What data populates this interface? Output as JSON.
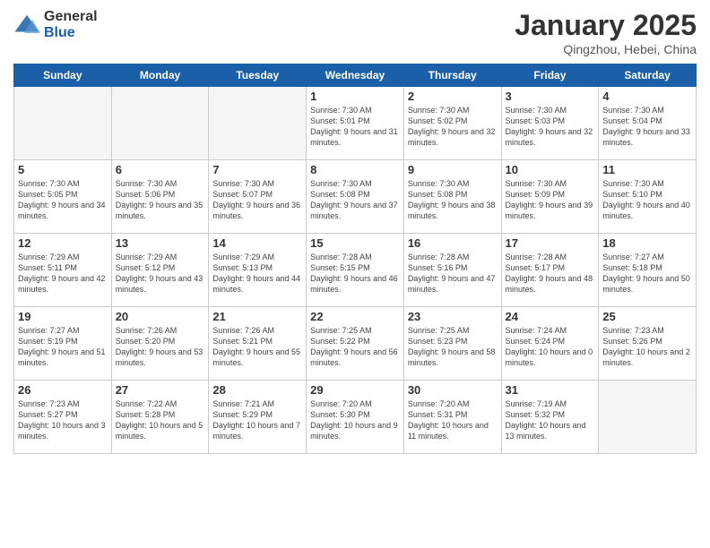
{
  "logo": {
    "general": "General",
    "blue": "Blue"
  },
  "header": {
    "month": "January 2025",
    "location": "Qingzhou, Hebei, China"
  },
  "weekdays": [
    "Sunday",
    "Monday",
    "Tuesday",
    "Wednesday",
    "Thursday",
    "Friday",
    "Saturday"
  ],
  "weeks": [
    [
      {
        "day": "",
        "info": ""
      },
      {
        "day": "",
        "info": ""
      },
      {
        "day": "",
        "info": ""
      },
      {
        "day": "1",
        "info": "Sunrise: 7:30 AM\nSunset: 5:01 PM\nDaylight: 9 hours\nand 31 minutes."
      },
      {
        "day": "2",
        "info": "Sunrise: 7:30 AM\nSunset: 5:02 PM\nDaylight: 9 hours\nand 32 minutes."
      },
      {
        "day": "3",
        "info": "Sunrise: 7:30 AM\nSunset: 5:03 PM\nDaylight: 9 hours\nand 32 minutes."
      },
      {
        "day": "4",
        "info": "Sunrise: 7:30 AM\nSunset: 5:04 PM\nDaylight: 9 hours\nand 33 minutes."
      }
    ],
    [
      {
        "day": "5",
        "info": "Sunrise: 7:30 AM\nSunset: 5:05 PM\nDaylight: 9 hours\nand 34 minutes."
      },
      {
        "day": "6",
        "info": "Sunrise: 7:30 AM\nSunset: 5:06 PM\nDaylight: 9 hours\nand 35 minutes."
      },
      {
        "day": "7",
        "info": "Sunrise: 7:30 AM\nSunset: 5:07 PM\nDaylight: 9 hours\nand 36 minutes."
      },
      {
        "day": "8",
        "info": "Sunrise: 7:30 AM\nSunset: 5:08 PM\nDaylight: 9 hours\nand 37 minutes."
      },
      {
        "day": "9",
        "info": "Sunrise: 7:30 AM\nSunset: 5:08 PM\nDaylight: 9 hours\nand 38 minutes."
      },
      {
        "day": "10",
        "info": "Sunrise: 7:30 AM\nSunset: 5:09 PM\nDaylight: 9 hours\nand 39 minutes."
      },
      {
        "day": "11",
        "info": "Sunrise: 7:30 AM\nSunset: 5:10 PM\nDaylight: 9 hours\nand 40 minutes."
      }
    ],
    [
      {
        "day": "12",
        "info": "Sunrise: 7:29 AM\nSunset: 5:11 PM\nDaylight: 9 hours\nand 42 minutes."
      },
      {
        "day": "13",
        "info": "Sunrise: 7:29 AM\nSunset: 5:12 PM\nDaylight: 9 hours\nand 43 minutes."
      },
      {
        "day": "14",
        "info": "Sunrise: 7:29 AM\nSunset: 5:13 PM\nDaylight: 9 hours\nand 44 minutes."
      },
      {
        "day": "15",
        "info": "Sunrise: 7:28 AM\nSunset: 5:15 PM\nDaylight: 9 hours\nand 46 minutes."
      },
      {
        "day": "16",
        "info": "Sunrise: 7:28 AM\nSunset: 5:16 PM\nDaylight: 9 hours\nand 47 minutes."
      },
      {
        "day": "17",
        "info": "Sunrise: 7:28 AM\nSunset: 5:17 PM\nDaylight: 9 hours\nand 48 minutes."
      },
      {
        "day": "18",
        "info": "Sunrise: 7:27 AM\nSunset: 5:18 PM\nDaylight: 9 hours\nand 50 minutes."
      }
    ],
    [
      {
        "day": "19",
        "info": "Sunrise: 7:27 AM\nSunset: 5:19 PM\nDaylight: 9 hours\nand 51 minutes."
      },
      {
        "day": "20",
        "info": "Sunrise: 7:26 AM\nSunset: 5:20 PM\nDaylight: 9 hours\nand 53 minutes."
      },
      {
        "day": "21",
        "info": "Sunrise: 7:26 AM\nSunset: 5:21 PM\nDaylight: 9 hours\nand 55 minutes."
      },
      {
        "day": "22",
        "info": "Sunrise: 7:25 AM\nSunset: 5:22 PM\nDaylight: 9 hours\nand 56 minutes."
      },
      {
        "day": "23",
        "info": "Sunrise: 7:25 AM\nSunset: 5:23 PM\nDaylight: 9 hours\nand 58 minutes."
      },
      {
        "day": "24",
        "info": "Sunrise: 7:24 AM\nSunset: 5:24 PM\nDaylight: 10 hours\nand 0 minutes."
      },
      {
        "day": "25",
        "info": "Sunrise: 7:23 AM\nSunset: 5:26 PM\nDaylight: 10 hours\nand 2 minutes."
      }
    ],
    [
      {
        "day": "26",
        "info": "Sunrise: 7:23 AM\nSunset: 5:27 PM\nDaylight: 10 hours\nand 3 minutes."
      },
      {
        "day": "27",
        "info": "Sunrise: 7:22 AM\nSunset: 5:28 PM\nDaylight: 10 hours\nand 5 minutes."
      },
      {
        "day": "28",
        "info": "Sunrise: 7:21 AM\nSunset: 5:29 PM\nDaylight: 10 hours\nand 7 minutes."
      },
      {
        "day": "29",
        "info": "Sunrise: 7:20 AM\nSunset: 5:30 PM\nDaylight: 10 hours\nand 9 minutes."
      },
      {
        "day": "30",
        "info": "Sunrise: 7:20 AM\nSunset: 5:31 PM\nDaylight: 10 hours\nand 11 minutes."
      },
      {
        "day": "31",
        "info": "Sunrise: 7:19 AM\nSunset: 5:32 PM\nDaylight: 10 hours\nand 13 minutes."
      },
      {
        "day": "",
        "info": ""
      }
    ]
  ]
}
